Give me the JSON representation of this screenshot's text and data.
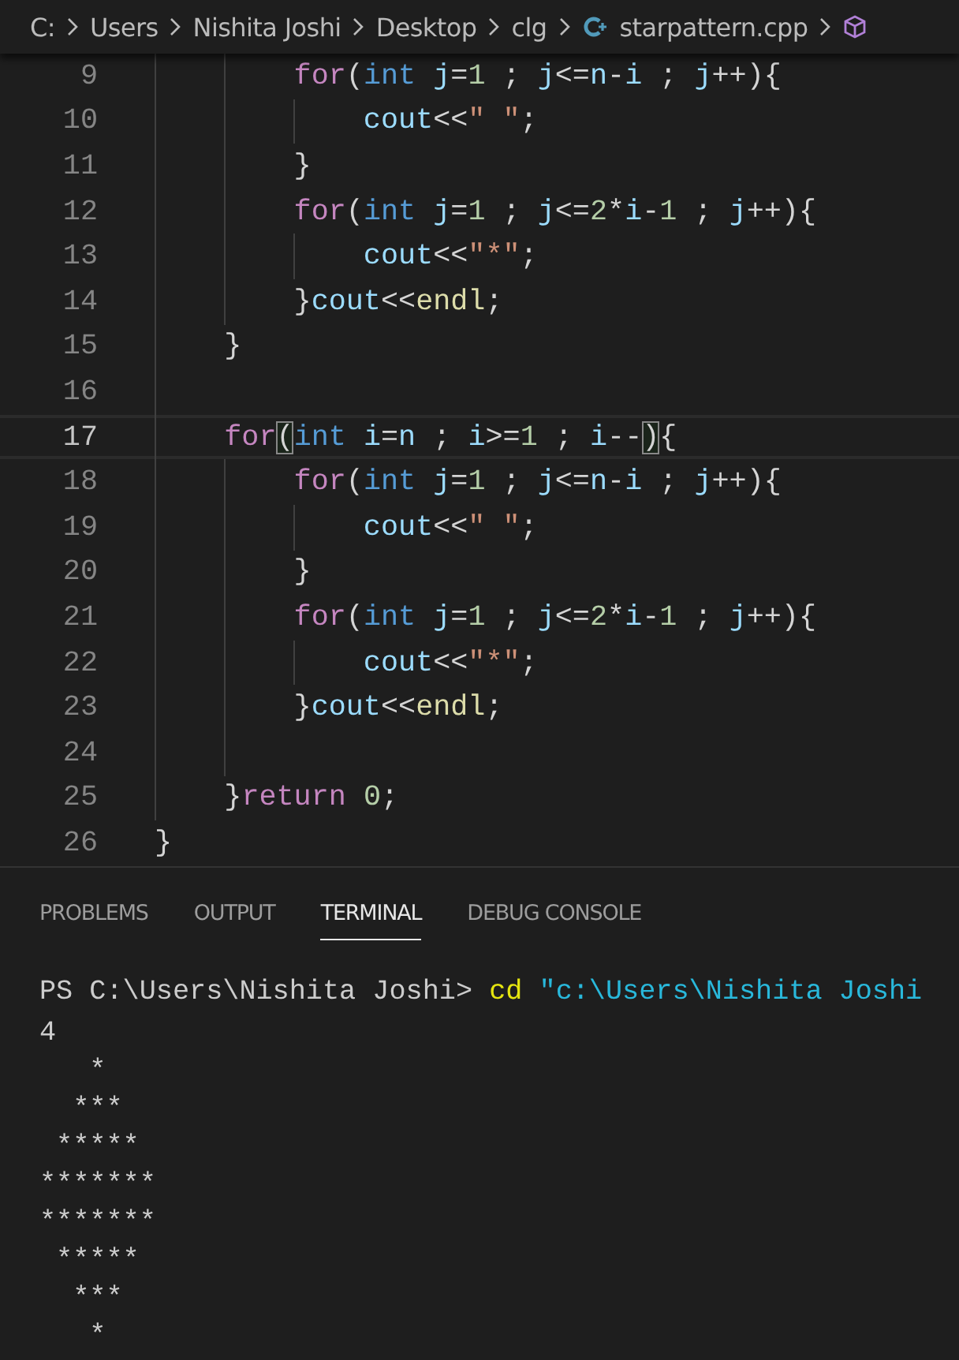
{
  "breadcrumb": {
    "segments": [
      {
        "label": "C:",
        "kind": "folder"
      },
      {
        "label": "Users",
        "kind": "folder"
      },
      {
        "label": "Nishita Joshi",
        "kind": "folder"
      },
      {
        "label": "Desktop",
        "kind": "folder"
      },
      {
        "label": "clg",
        "kind": "folder"
      },
      {
        "label": "starpattern.cpp",
        "kind": "file"
      },
      {
        "kind": "symbol"
      }
    ]
  },
  "editor": {
    "lines": [
      {
        "number": "9",
        "current": false,
        "tokens": [
          {
            "text": "        for",
            "kind": "keyword"
          },
          {
            "text": "(",
            "kind": "punct"
          },
          {
            "text": "int",
            "kind": "type"
          },
          {
            "text": " j",
            "kind": "var"
          },
          {
            "text": "=",
            "kind": "punct"
          },
          {
            "text": "1",
            "kind": "number"
          },
          {
            "text": " ; ",
            "kind": "punct"
          },
          {
            "text": "j",
            "kind": "var"
          },
          {
            "text": "<=",
            "kind": "punct"
          },
          {
            "text": "n",
            "kind": "var"
          },
          {
            "text": "-",
            "kind": "punct"
          },
          {
            "text": "i",
            "kind": "var"
          },
          {
            "text": " ; ",
            "kind": "punct"
          },
          {
            "text": "j",
            "kind": "var"
          },
          {
            "text": "++){",
            "kind": "punct"
          }
        ]
      },
      {
        "number": "10",
        "current": false,
        "tokens": [
          {
            "text": "            cout",
            "kind": "var"
          },
          {
            "text": "<<",
            "kind": "punct"
          },
          {
            "text": "\" \"",
            "kind": "string"
          },
          {
            "text": ";",
            "kind": "punct"
          }
        ]
      },
      {
        "number": "11",
        "current": false,
        "tokens": [
          {
            "text": "        }",
            "kind": "punct"
          }
        ]
      },
      {
        "number": "12",
        "current": false,
        "tokens": [
          {
            "text": "        for",
            "kind": "keyword"
          },
          {
            "text": "(",
            "kind": "punct"
          },
          {
            "text": "int",
            "kind": "type"
          },
          {
            "text": " j",
            "kind": "var"
          },
          {
            "text": "=",
            "kind": "punct"
          },
          {
            "text": "1",
            "kind": "number"
          },
          {
            "text": " ; ",
            "kind": "punct"
          },
          {
            "text": "j",
            "kind": "var"
          },
          {
            "text": "<=",
            "kind": "punct"
          },
          {
            "text": "2",
            "kind": "number"
          },
          {
            "text": "*",
            "kind": "punct"
          },
          {
            "text": "i",
            "kind": "var"
          },
          {
            "text": "-",
            "kind": "punct"
          },
          {
            "text": "1",
            "kind": "number"
          },
          {
            "text": " ; ",
            "kind": "punct"
          },
          {
            "text": "j",
            "kind": "var"
          },
          {
            "text": "++){",
            "kind": "punct"
          }
        ]
      },
      {
        "number": "13",
        "current": false,
        "tokens": [
          {
            "text": "            cout",
            "kind": "var"
          },
          {
            "text": "<<",
            "kind": "punct"
          },
          {
            "text": "\"*\"",
            "kind": "string"
          },
          {
            "text": ";",
            "kind": "punct"
          }
        ]
      },
      {
        "number": "14",
        "current": false,
        "tokens": [
          {
            "text": "        }",
            "kind": "punct"
          },
          {
            "text": "cout",
            "kind": "var"
          },
          {
            "text": "<<",
            "kind": "punct"
          },
          {
            "text": "endl",
            "kind": "function"
          },
          {
            "text": ";",
            "kind": "punct"
          }
        ]
      },
      {
        "number": "15",
        "current": false,
        "tokens": [
          {
            "text": "    }",
            "kind": "punct"
          }
        ]
      },
      {
        "number": "16",
        "current": false
      },
      {
        "number": "17",
        "current": true,
        "tokens": [
          {
            "text": "    for",
            "kind": "keyword"
          },
          {
            "text": "(",
            "kind": "bracket-match"
          },
          {
            "text": "int",
            "kind": "type"
          },
          {
            "text": " i",
            "kind": "var"
          },
          {
            "text": "=",
            "kind": "punct"
          },
          {
            "text": "n",
            "kind": "var"
          },
          {
            "text": " ; ",
            "kind": "punct"
          },
          {
            "text": "i",
            "kind": "var"
          },
          {
            "text": ">=",
            "kind": "punct"
          },
          {
            "text": "1",
            "kind": "number"
          },
          {
            "text": " ; ",
            "kind": "punct"
          },
          {
            "text": "i",
            "kind": "var"
          },
          {
            "text": "--",
            "kind": "punct"
          },
          {
            "text": ")",
            "kind": "bracket-match"
          },
          {
            "text": "{",
            "kind": "punct"
          }
        ]
      },
      {
        "number": "18",
        "current": false,
        "tokens": [
          {
            "text": "        for",
            "kind": "keyword"
          },
          {
            "text": "(",
            "kind": "punct"
          },
          {
            "text": "int",
            "kind": "type"
          },
          {
            "text": " j",
            "kind": "var"
          },
          {
            "text": "=",
            "kind": "punct"
          },
          {
            "text": "1",
            "kind": "number"
          },
          {
            "text": " ; ",
            "kind": "punct"
          },
          {
            "text": "j",
            "kind": "var"
          },
          {
            "text": "<=",
            "kind": "punct"
          },
          {
            "text": "n",
            "kind": "var"
          },
          {
            "text": "-",
            "kind": "punct"
          },
          {
            "text": "i",
            "kind": "var"
          },
          {
            "text": " ; ",
            "kind": "punct"
          },
          {
            "text": "j",
            "kind": "var"
          },
          {
            "text": "++){",
            "kind": "punct"
          }
        ]
      },
      {
        "number": "19",
        "current": false,
        "tokens": [
          {
            "text": "            cout",
            "kind": "var"
          },
          {
            "text": "<<",
            "kind": "punct"
          },
          {
            "text": "\" \"",
            "kind": "string"
          },
          {
            "text": ";",
            "kind": "punct"
          }
        ]
      },
      {
        "number": "20",
        "current": false,
        "tokens": [
          {
            "text": "        }",
            "kind": "punct"
          }
        ]
      },
      {
        "number": "21",
        "current": false,
        "tokens": [
          {
            "text": "        for",
            "kind": "keyword"
          },
          {
            "text": "(",
            "kind": "punct"
          },
          {
            "text": "int",
            "kind": "type"
          },
          {
            "text": " j",
            "kind": "var"
          },
          {
            "text": "=",
            "kind": "punct"
          },
          {
            "text": "1",
            "kind": "number"
          },
          {
            "text": " ; ",
            "kind": "punct"
          },
          {
            "text": "j",
            "kind": "var"
          },
          {
            "text": "<=",
            "kind": "punct"
          },
          {
            "text": "2",
            "kind": "number"
          },
          {
            "text": "*",
            "kind": "punct"
          },
          {
            "text": "i",
            "kind": "var"
          },
          {
            "text": "-",
            "kind": "punct"
          },
          {
            "text": "1",
            "kind": "number"
          },
          {
            "text": " ; ",
            "kind": "punct"
          },
          {
            "text": "j",
            "kind": "var"
          },
          {
            "text": "++){",
            "kind": "punct"
          }
        ]
      },
      {
        "number": "22",
        "current": false,
        "tokens": [
          {
            "text": "            cout",
            "kind": "var"
          },
          {
            "text": "<<",
            "kind": "punct"
          },
          {
            "text": "\"*\"",
            "kind": "string"
          },
          {
            "text": ";",
            "kind": "punct"
          }
        ]
      },
      {
        "number": "23",
        "current": false,
        "tokens": [
          {
            "text": "        }",
            "kind": "punct"
          },
          {
            "text": "cout",
            "kind": "var"
          },
          {
            "text": "<<",
            "kind": "punct"
          },
          {
            "text": "endl",
            "kind": "function"
          },
          {
            "text": ";",
            "kind": "punct"
          }
        ]
      },
      {
        "number": "24",
        "current": false
      },
      {
        "number": "25",
        "current": false,
        "tokens": [
          {
            "text": "    }",
            "kind": "punct"
          },
          {
            "text": "return",
            "kind": "keyword"
          },
          {
            "text": " 0",
            "kind": "number"
          },
          {
            "text": ";",
            "kind": "punct"
          }
        ]
      },
      {
        "number": "26",
        "current": false,
        "tokens": [
          {
            "text": "}",
            "kind": "punct"
          }
        ]
      }
    ]
  },
  "panel": {
    "tabs": [
      {
        "label": "PROBLEMS",
        "selected": false
      },
      {
        "label": "OUTPUT",
        "selected": false
      },
      {
        "label": "TERMINAL",
        "selected": true
      },
      {
        "label": "DEBUG CONSOLE",
        "selected": false
      }
    ],
    "terminal": {
      "prompt": [
        {
          "text": "PS C:\\Users\\Nishita Joshi> ",
          "kind": "plain"
        },
        {
          "text": "cd",
          "kind": "command"
        },
        {
          "text": " \"c:\\Users\\Nishita Joshi",
          "kind": "string"
        }
      ],
      "output": "4\n   *\n  ***\n *****\n*******\n*******\n *****\n  ***\n   *"
    }
  }
}
